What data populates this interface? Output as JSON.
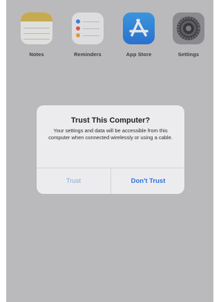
{
  "apps": [
    {
      "label": "Notes",
      "icon": "notes-icon"
    },
    {
      "label": "Reminders",
      "icon": "reminders-icon"
    },
    {
      "label": "App Store",
      "icon": "app-store-icon"
    },
    {
      "label": "Settings",
      "icon": "settings-icon"
    }
  ],
  "dialog": {
    "title": "Trust This Computer?",
    "message": "Your settings and data will be accessible from this computer when connected wirelessly or using a cable.",
    "buttons": {
      "trust": "Trust",
      "dont_trust": "Don't Trust"
    }
  },
  "colors": {
    "background": "#c9c9cb",
    "alert_background": "#ececee",
    "button_text": "#2f6fd8",
    "notes_accent": "#d8b545",
    "appstore_blue": "#1a6fe0"
  }
}
